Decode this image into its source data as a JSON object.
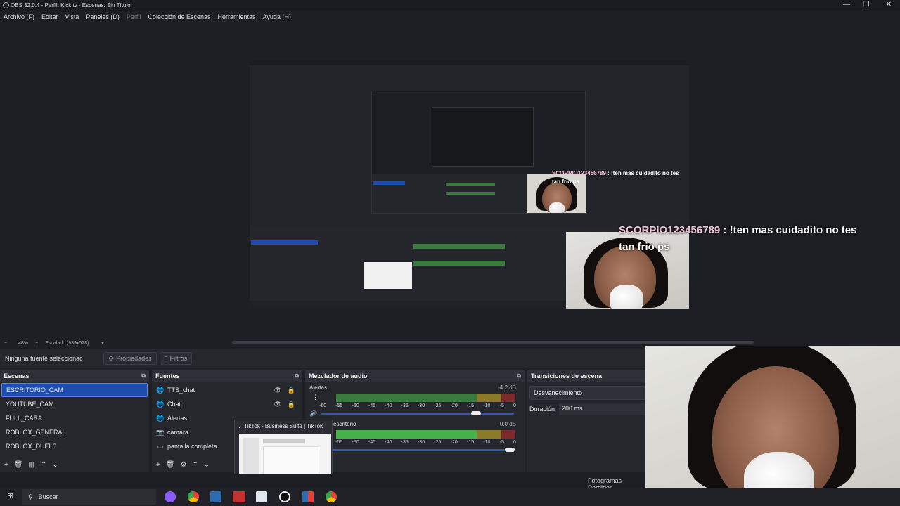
{
  "window": {
    "title": "OBS 32.0.4 - Perfil: Kick.tv - Escenas: Sin Título",
    "minimize": "—",
    "restore": "❐",
    "close": "✕"
  },
  "menu": [
    "Archivo (F)",
    "Editar",
    "Vista",
    "Paneles (D)",
    "Perfil",
    "Colección de Escenas",
    "Herramientas",
    "Ayuda (H)"
  ],
  "preview": {
    "chat_user": "SCORPIO123456789",
    "chat_message": " : !ten mas cuidadito no tes",
    "chat_message_cont": "tan frio ps"
  },
  "zoombar": {
    "minus": "−",
    "zoom": "48%",
    "plus": "+",
    "scale": "Escalado (939x528)",
    "dropdown": "▼"
  },
  "source_toolbar": {
    "no_source": "Ninguna fuente seleccionac",
    "properties": "Propiedades",
    "filters": "Filtros"
  },
  "scenes": {
    "title": "Escenas",
    "items": [
      "ESCRITORIO_CAM",
      "YOUTUBE_CAM",
      "FULL_CARA",
      "ROBLOX_GENERAL",
      "ROBLOX_DUELS"
    ],
    "selected": "ESCRITORIO_CAM"
  },
  "sources": {
    "title": "Fuentes",
    "items": [
      {
        "name": "TTS_chat",
        "icon": "globe-icon"
      },
      {
        "name": "Chat",
        "icon": "globe-icon"
      },
      {
        "name": "Alertas",
        "icon": "globe-icon"
      },
      {
        "name": "camara",
        "icon": "camera-icon"
      },
      {
        "name": "pantalla completa",
        "icon": "monitor-icon"
      }
    ]
  },
  "mixer": {
    "title": "Mezclador de audio",
    "channels": [
      {
        "name": "Alertas",
        "db": "-4.2 dB",
        "volume": 0.9
      },
      {
        "name": "escritorio",
        "db": "0.0 dB",
        "volume": 1.0
      }
    ],
    "ticks": [
      "-60",
      "-55",
      "-50",
      "-45",
      "-40",
      "-35",
      "-30",
      "-25",
      "-20",
      "-15",
      "-10",
      "-5",
      "0"
    ]
  },
  "transitions": {
    "title": "Transiciones de escena",
    "type": "Desvanecimiento",
    "duration_label": "Duración",
    "duration_value": "200 ms"
  },
  "tiktok_popup": {
    "title": "TikTok - Business Suite | TikTok"
  },
  "status": {
    "frames": "Fotogramas Perdidos"
  },
  "taskbar": {
    "search": "Buscar"
  },
  "colors": {
    "selection": "#1e4dad",
    "panel": "#26272d",
    "chat_user": "#f0c2d6"
  }
}
